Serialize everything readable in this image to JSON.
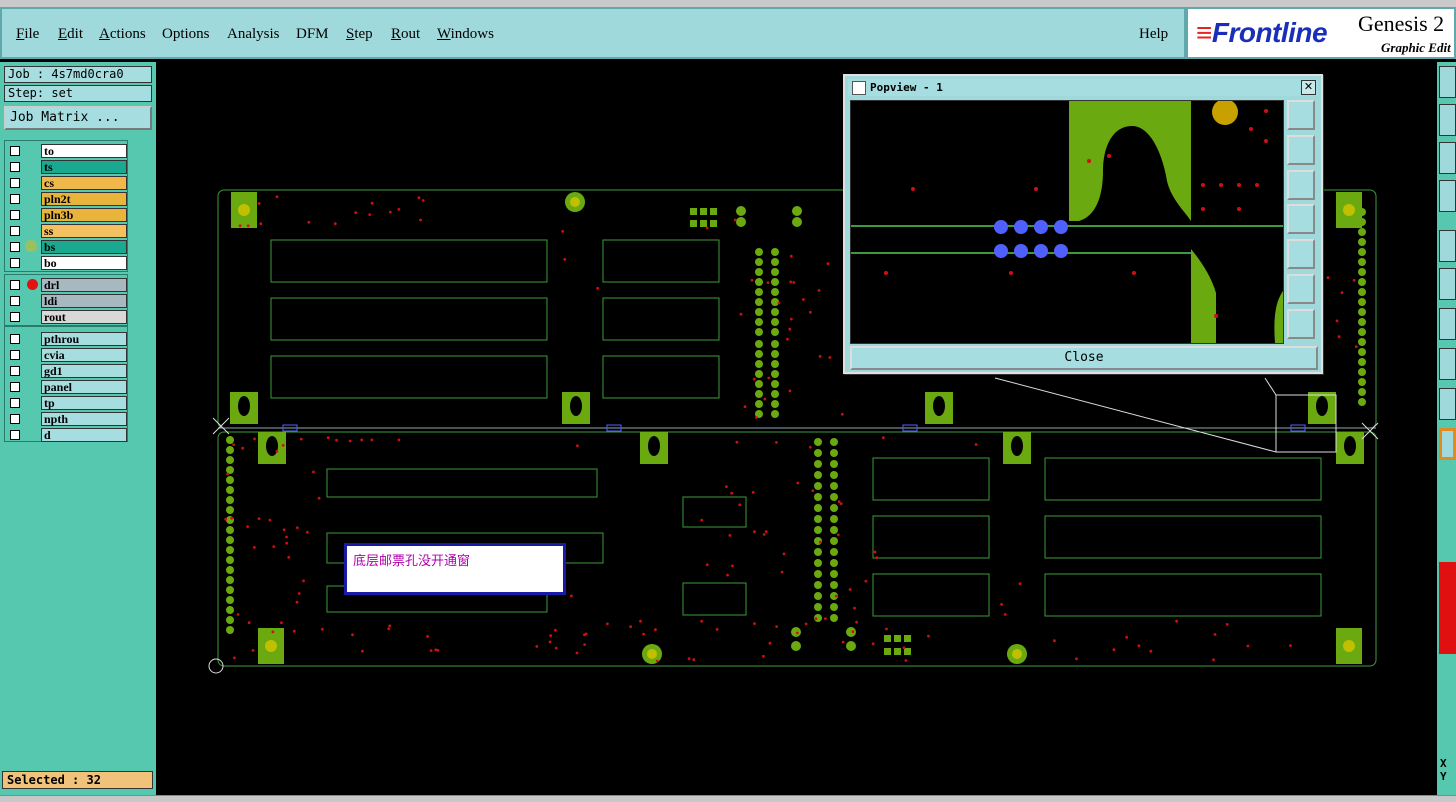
{
  "menu": {
    "items": [
      "File",
      "Edit",
      "Actions",
      "Options",
      "Analysis",
      "DFM",
      "Step",
      "Rout",
      "Windows"
    ],
    "help": "Help"
  },
  "brand": {
    "logo": "Frontline",
    "title": "Genesis 2",
    "subtitle": "Graphic Edit"
  },
  "job": {
    "name_label": "Job : 4s7md0cra0",
    "step_label": "Step: set",
    "matrix_button": "Job Matrix ..."
  },
  "layers": {
    "group1": [
      {
        "name": "to",
        "color": "#ffffff"
      },
      {
        "name": "ts",
        "color": "#1aa890"
      },
      {
        "name": "cs",
        "color": "#f0b84a"
      },
      {
        "name": "pln2t",
        "color": "#e8b43c"
      },
      {
        "name": "pln3b",
        "color": "#e8b43c"
      },
      {
        "name": "ss",
        "color": "#f5c060"
      },
      {
        "name": "bs",
        "color": "#1aa890"
      },
      {
        "name": "bo",
        "color": "#ffffff"
      }
    ],
    "group2": [
      {
        "name": "drl",
        "color": "#a8b8c0"
      },
      {
        "name": "ldi",
        "color": "#a8b8c0"
      },
      {
        "name": "rout",
        "color": "#d8d8d8"
      }
    ],
    "group3": [
      {
        "name": "pthrou",
        "color": "#a5dde0"
      },
      {
        "name": "cvia",
        "color": "#a5dde0"
      },
      {
        "name": "gd1",
        "color": "#a5dde0"
      },
      {
        "name": "panel",
        "color": "#a5dde0"
      },
      {
        "name": "tp",
        "color": "#a5dde0"
      },
      {
        "name": "npth",
        "color": "#a5dde0"
      },
      {
        "name": "d",
        "color": "#a5dde0"
      }
    ]
  },
  "status": {
    "selected": "Selected : 32",
    "xy": "X Y"
  },
  "popview": {
    "title": "Popview - 1",
    "close_button": "Close",
    "close_x": "✕"
  },
  "note": {
    "text": "底层邮票孔没开通窗"
  },
  "colors": {
    "panel": "#56c8b0",
    "menubar": "#9fd9dc",
    "copper": "#6aaa10",
    "pad": "#c0c000",
    "outline": "#3c9a3c",
    "drill": "#d01010",
    "highlight": "#5060ff"
  }
}
